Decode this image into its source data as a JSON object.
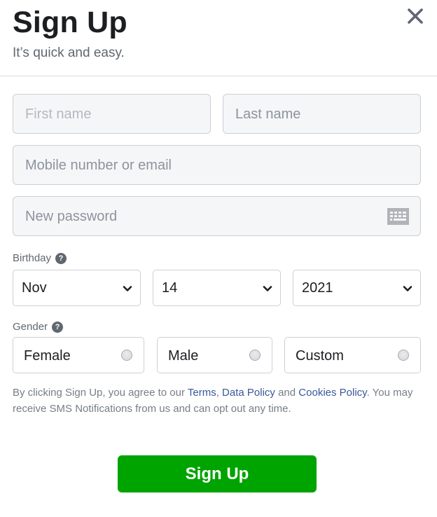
{
  "header": {
    "title": "Sign Up",
    "subtitle": "It’s quick and easy.",
    "close_icon": "close-icon"
  },
  "form": {
    "first_name": {
      "placeholder": "First name",
      "value": ""
    },
    "last_name": {
      "placeholder": "Last name",
      "value": ""
    },
    "contact": {
      "placeholder": "Mobile number or email",
      "value": ""
    },
    "password": {
      "placeholder": "New password",
      "value": "",
      "icon": "keyboard-icon"
    },
    "birthday": {
      "label": "Birthday",
      "help_icon": "?",
      "month": "Nov",
      "day": "14",
      "year": "2021"
    },
    "gender": {
      "label": "Gender",
      "help_icon": "?",
      "options": [
        "Female",
        "Male",
        "Custom"
      ],
      "selected": null
    }
  },
  "legal": {
    "part1": "By clicking Sign Up, you agree to our ",
    "terms": "Terms",
    "sep1": ", ",
    "data_policy": "Data Policy",
    "sep2": " and ",
    "cookies_policy": "Cookies Policy",
    "part2": ". You may receive SMS Notifications from us and can opt out any time."
  },
  "submit": {
    "label": "Sign Up"
  },
  "colors": {
    "primary_button": "#00a400",
    "link": "#385898",
    "field_bg": "#f5f6f7",
    "border": "#ccd0d5"
  }
}
